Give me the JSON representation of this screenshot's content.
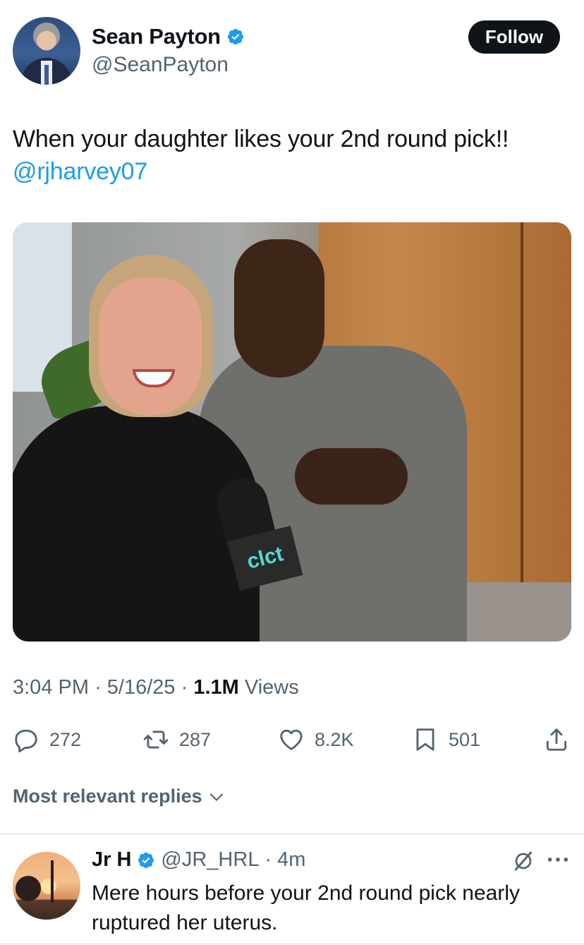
{
  "tweet": {
    "author": {
      "display_name": "Sean Payton",
      "handle": "@SeanPayton",
      "verified": true
    },
    "follow_label": "Follow",
    "text": "When your daughter likes your 2nd round pick!!",
    "mention": "@rjharvey07",
    "media": {
      "mic_flag_text": "clct"
    },
    "meta": {
      "time": "3:04 PM",
      "separator": "·",
      "date": "5/16/25",
      "views_count": "1.1M",
      "views_label": "Views"
    },
    "actions": {
      "replies": "272",
      "reposts": "287",
      "likes": "8.2K",
      "bookmarks": "501"
    }
  },
  "replies_section": {
    "filter_label": "Most relevant replies"
  },
  "reply": {
    "display_name": "Jr H",
    "verified": true,
    "handle": "@JR_HRL",
    "separator": "·",
    "time": "4m",
    "text": "Mere hours before your 2nd round pick nearly ruptured her uterus."
  },
  "colors": {
    "accent": "#1d9bf0",
    "secondary_text": "#536471",
    "primary_text": "#0f1419",
    "follow_button": "#0f1419"
  },
  "icons": [
    "verified-badge-icon",
    "reply-icon",
    "repost-icon",
    "like-icon",
    "bookmark-icon",
    "share-icon",
    "chevron-down-icon",
    "grok-icon",
    "more-icon"
  ]
}
